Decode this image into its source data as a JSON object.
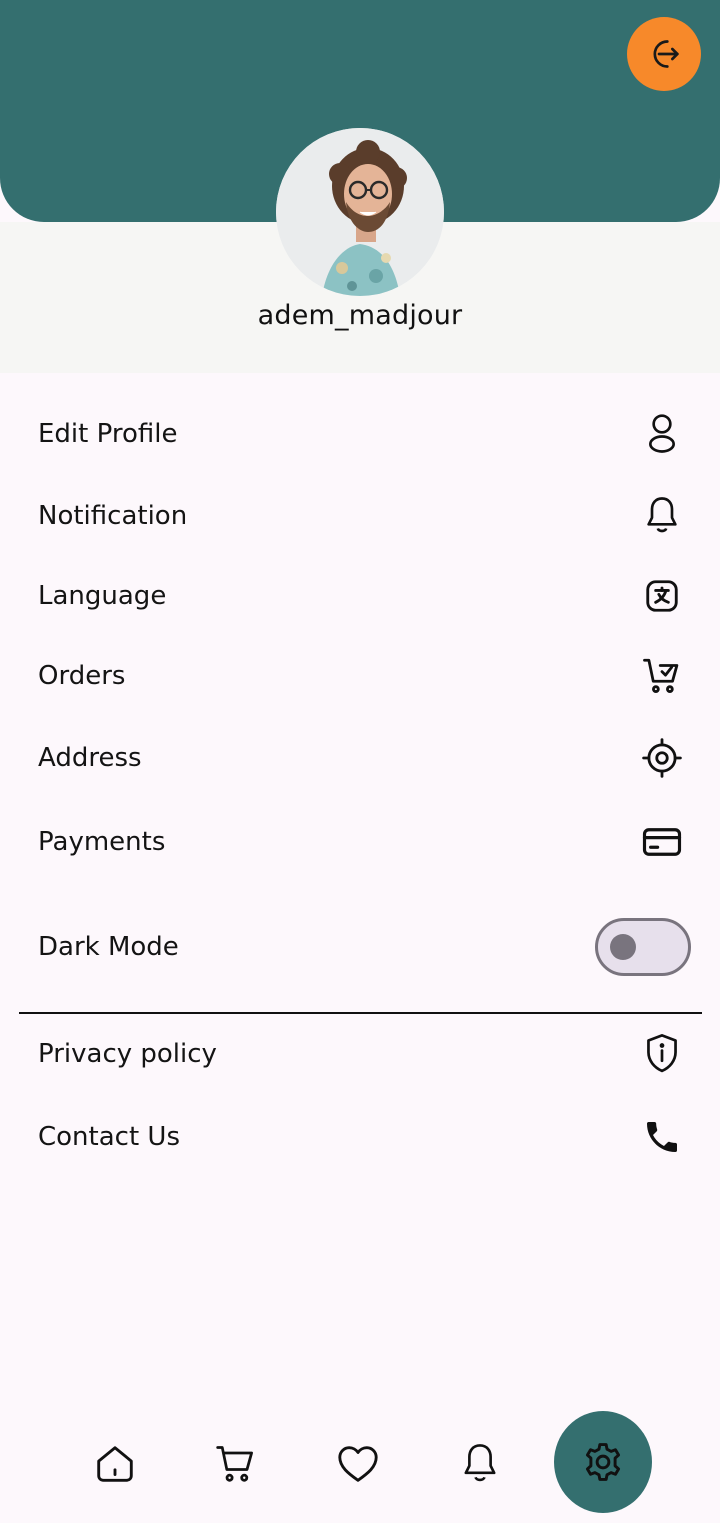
{
  "colors": {
    "header": "#346f6f",
    "logout_accent": "#f7892a",
    "toggle_track": "#e7e0ec",
    "toggle_outline": "#79747e",
    "background": "#fdf8fc"
  },
  "header": {
    "logout_icon": "logout-icon"
  },
  "profile": {
    "username": "adem_madjour",
    "avatar": "avatar-photo"
  },
  "menu": {
    "edit_profile": {
      "label": "Edit Profile",
      "icon": "user-icon"
    },
    "notification": {
      "label": "Notification",
      "icon": "bell-icon"
    },
    "language": {
      "label": "Language",
      "icon": "translate-icon"
    },
    "orders": {
      "label": "Orders",
      "icon": "cart-check-icon"
    },
    "address": {
      "label": "Address",
      "icon": "location-target-icon"
    },
    "payments": {
      "label": "Payments",
      "icon": "credit-card-icon"
    },
    "dark_mode": {
      "label": "Dark Mode",
      "enabled": false
    },
    "privacy_policy": {
      "label": "Privacy policy",
      "icon": "shield-info-icon"
    },
    "contact_us": {
      "label": "Contact Us",
      "icon": "phone-icon"
    }
  },
  "bottom_nav": {
    "items": [
      "home-icon",
      "cart-icon",
      "heart-icon",
      "bell-icon",
      "gear-icon"
    ],
    "active": "gear-icon"
  }
}
